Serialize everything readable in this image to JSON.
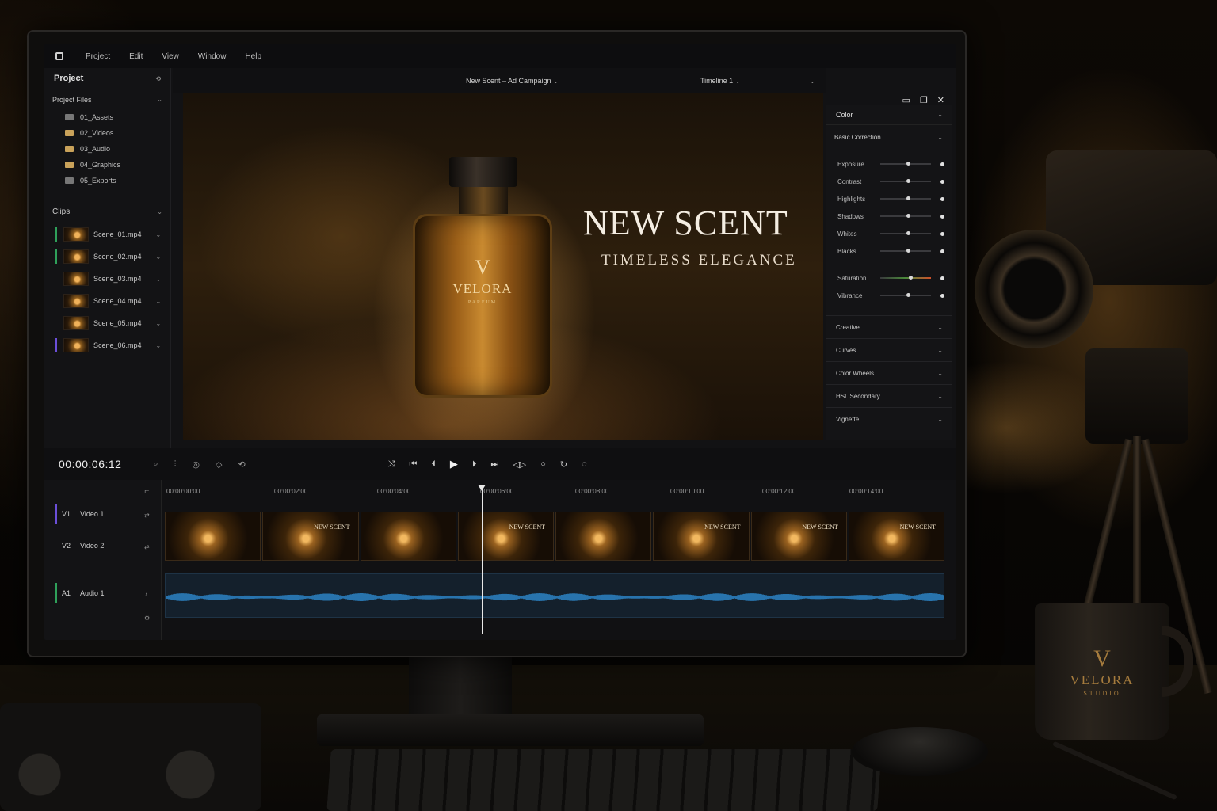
{
  "menu": {
    "items": [
      "Project",
      "Edit",
      "View",
      "Window",
      "Help"
    ]
  },
  "project_panel": {
    "title": "Project",
    "files_header": "Project Files",
    "folders": [
      "01_Assets",
      "02_Videos",
      "03_Audio",
      "04_Graphics",
      "05_Exports"
    ],
    "clips_header": "Clips",
    "clips": [
      "Scene_01.mp4",
      "Scene_02.mp4",
      "Scene_03.mp4",
      "Scene_04.mp4",
      "Scene_05.mp4",
      "Scene_06.mp4"
    ]
  },
  "viewer": {
    "project_name": "New Scent – Ad Campaign",
    "timeline_name": "Timeline 1",
    "bottle_monogram": "V",
    "bottle_brand": "VELORA",
    "bottle_sub": "PARFUM",
    "headline": "NEW SCENT",
    "tagline": "TIMELESS ELEGANCE"
  },
  "color_panel": {
    "title": "Color",
    "basic_title": "Basic Correction",
    "sliders": [
      {
        "label": "Exposure",
        "value": 0.55
      },
      {
        "label": "Contrast",
        "value": 0.55
      },
      {
        "label": "Highlights",
        "value": 0.55
      },
      {
        "label": "Shadows",
        "value": 0.55
      },
      {
        "label": "Whites",
        "value": 0.55
      },
      {
        "label": "Blacks",
        "value": 0.55
      }
    ],
    "sliders2": [
      {
        "label": "Saturation",
        "value": 0.6
      },
      {
        "label": "Vibrance",
        "value": 0.55
      }
    ],
    "sections": [
      "Creative",
      "Curves",
      "Color Wheels",
      "HSL Secondary",
      "Vignette"
    ]
  },
  "transport": {
    "timecode": "00:00:06:12"
  },
  "timeline": {
    "ruler": [
      "00:00:00:00",
      "00:00:02:00",
      "00:00:04:00",
      "00:00:06:00",
      "00:00:08:00",
      "00:00:10:00",
      "00:00:12:00",
      "00:00:14:00"
    ],
    "tracks": [
      {
        "id": "V1",
        "name": "Video 1"
      },
      {
        "id": "V2",
        "name": "Video 2"
      },
      {
        "id": "A1",
        "name": "Audio 1"
      }
    ],
    "clip_overlay_text": "NEW SCENT"
  },
  "mug": {
    "monogram": "V",
    "brand": "VELORA",
    "sub": "STUDIO"
  },
  "colors": {
    "accent_gold": "#c9a25a",
    "audio_blue": "#2f8fd8",
    "track_purple": "#6b4fd8",
    "track_green": "#2fa05a"
  }
}
